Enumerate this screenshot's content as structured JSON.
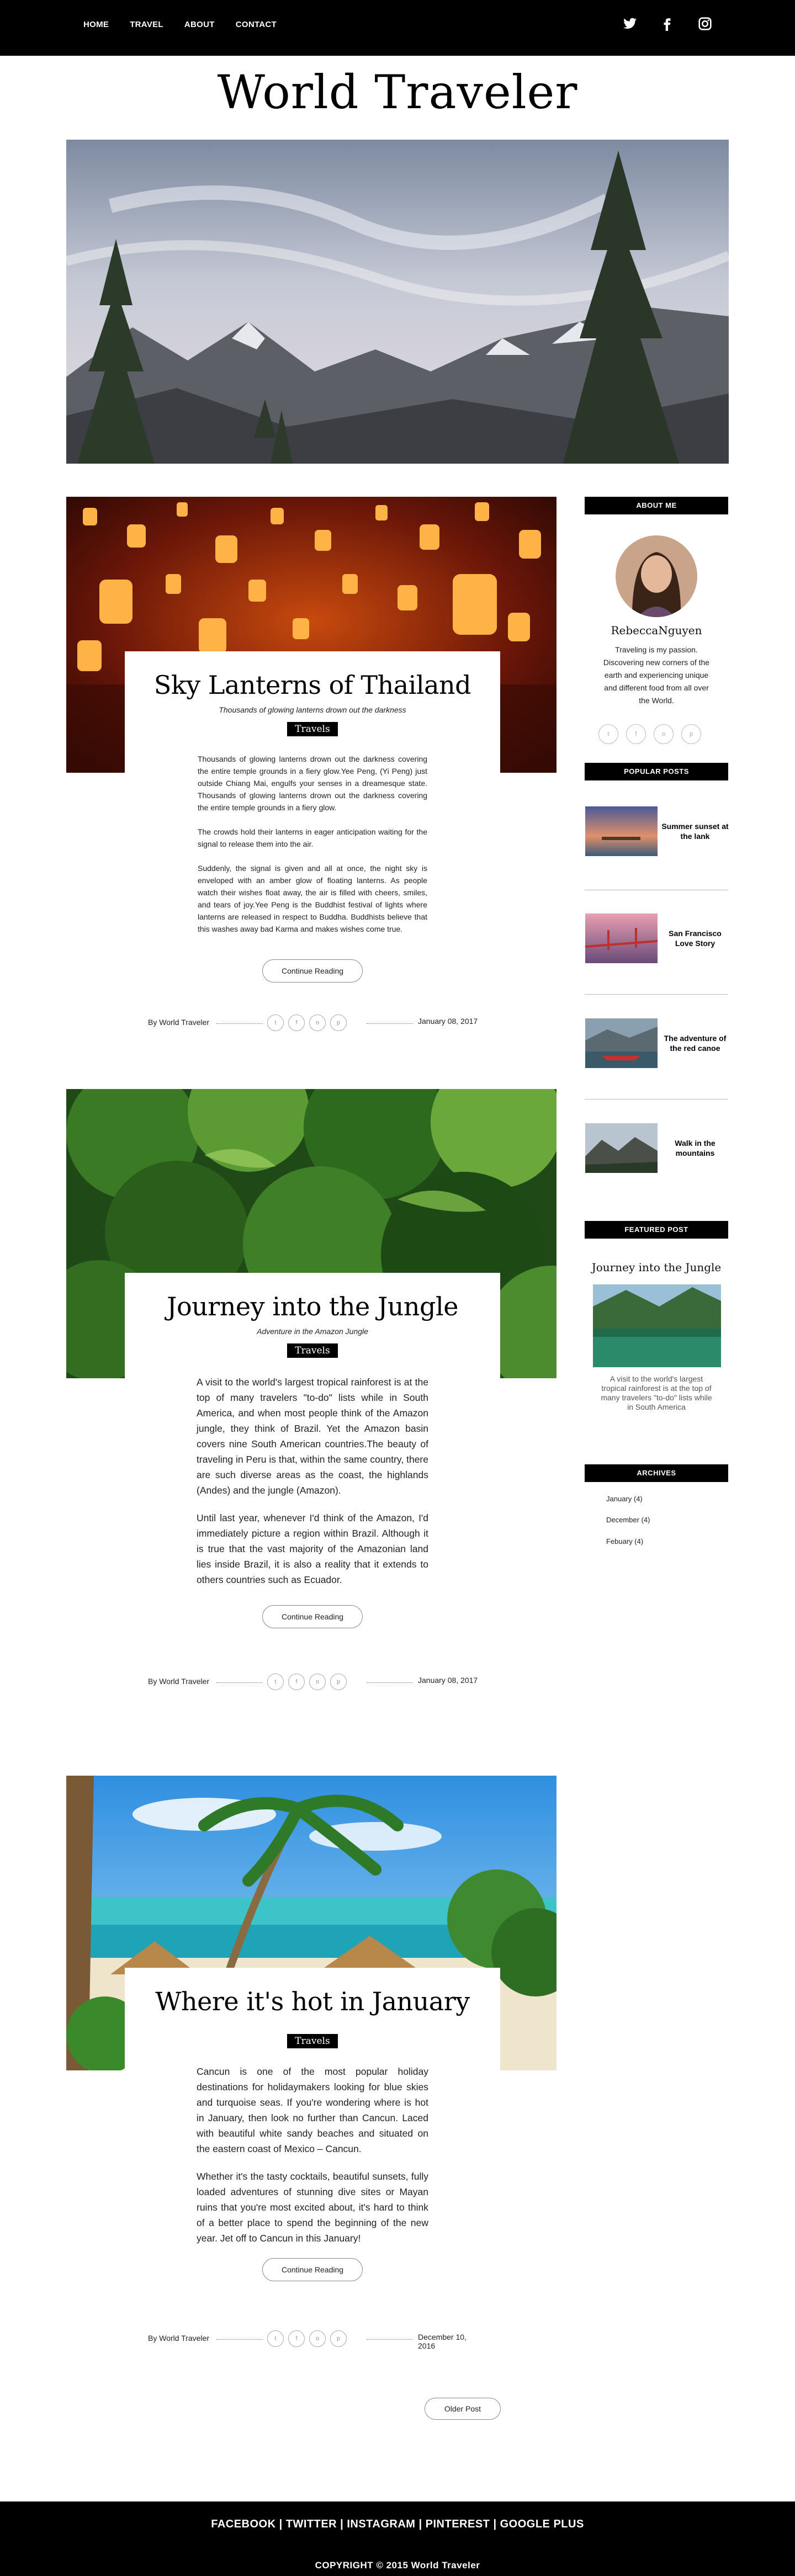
{
  "nav": {
    "links": [
      "HOME",
      "TRAVEL",
      "ABOUT",
      "CONTACT"
    ],
    "social_icons": [
      "twitter-icon",
      "facebook-icon",
      "instagram-icon"
    ]
  },
  "site_title": "World Traveler",
  "posts": [
    {
      "title": "Sky Lanterns of Thailand",
      "subtitle": "Thousands of glowing lanterns drown out the darkness",
      "tag": "Travels",
      "paragraphs": [
        "Thousands of glowing lanterns drown out the darkness covering the entire temple grounds in a fiery glow.Yee Peng, (Yi Peng) just outside Chiang Mai, engulfs your senses in a dreamesque state. Thousands of glowing lanterns drown out the darkness covering the entire temple grounds in a fiery glow.",
        "The crowds hold their lanterns in eager anticipation waiting for the signal to release them into the air.",
        "Suddenly, the signal is given and all at once, the night sky is enveloped with an amber glow of floating lanterns. As people watch their wishes float away, the air is filled with cheers, smiles, and tears of joy.Yee Peng is the Buddhist festival of lights where lanterns are released in respect to Buddha. Buddhists believe that this washes away bad Karma and makes wishes come true."
      ],
      "button": "Continue Reading",
      "author": "By World Traveler",
      "date": "January 08, 2017"
    },
    {
      "title": "Journey into the Jungle",
      "subtitle": "Adventure in the Amazon Jungle",
      "tag": "Travels",
      "paragraphs": [
        "A visit to the world's largest tropical rainforest is at the top of many travelers \"to-do\" lists while in South America, and when most people think of the Amazon jungle, they think of Brazil. Yet the Amazon basin covers nine South American countries.The beauty of traveling in Peru is that, within the same country, there are such diverse areas as the coast, the highlands (Andes) and the jungle (Amazon).",
        "Until last year, whenever I'd think of the Amazon, I'd immediately picture a region within Brazil. Although it is true that the vast majority of the Amazonian land lies inside Brazil, it is also a reality that it extends to others countries such as Ecuador."
      ],
      "button": "Continue Reading",
      "author": "By World Traveler",
      "date": "January 08, 2017"
    },
    {
      "title": "Where it's hot in January",
      "subtitle": "",
      "tag": "Travels",
      "paragraphs": [
        "Cancun is one of the most popular holiday destinations for holidaymakers looking for blue skies and turquoise seas. If you're wondering where is hot in January, then look no further than Cancun. Laced with beautiful white sandy beaches and situated on the eastern coast of Mexico – Cancun.",
        "Whether it's the tasty cocktails, beautiful sunsets, fully loaded adventures of stunning dive sites or Mayan ruins that you're most excited about, it's hard to think of a better place to spend the beginning of the new year. Jet off to Cancun in this January!"
      ],
      "button": "Continue Reading",
      "author": "By World Traveler",
      "date": "December 10, 2016"
    }
  ],
  "older_button": "Older Post",
  "sidebar": {
    "about": {
      "heading": "ABOUT ME",
      "name": "RebeccaNguyen",
      "bio": "Traveling is my passion. Discovering new corners of the earth and experiencing unique and different food from all over the World."
    },
    "popular": {
      "heading": "POPULAR POSTS",
      "items": [
        "Summer sunset at the lank",
        "San Francisco Love Story",
        "The adventure of the red canoe",
        "Walk in the mountains"
      ]
    },
    "featured": {
      "heading": "FEATURED POST",
      "title": "Journey into the Jungle",
      "caption": "A visit to the world's largest tropical rainforest is at the top of many travelers \"to-do\" lists while in South America"
    },
    "archives": {
      "heading": "ARCHIVES",
      "items": [
        "January (4)",
        "December (4)",
        "Febuary (4)"
      ]
    }
  },
  "footer": {
    "links": "FACEBOOK | TWITTER |  INSTAGRAM  | PINTEREST | GOOGLE PLUS",
    "copyright": "COPYRIGHT © 2015 World Traveler"
  },
  "colors": {
    "black": "#000000",
    "white": "#ffffff",
    "text": "#222222"
  }
}
